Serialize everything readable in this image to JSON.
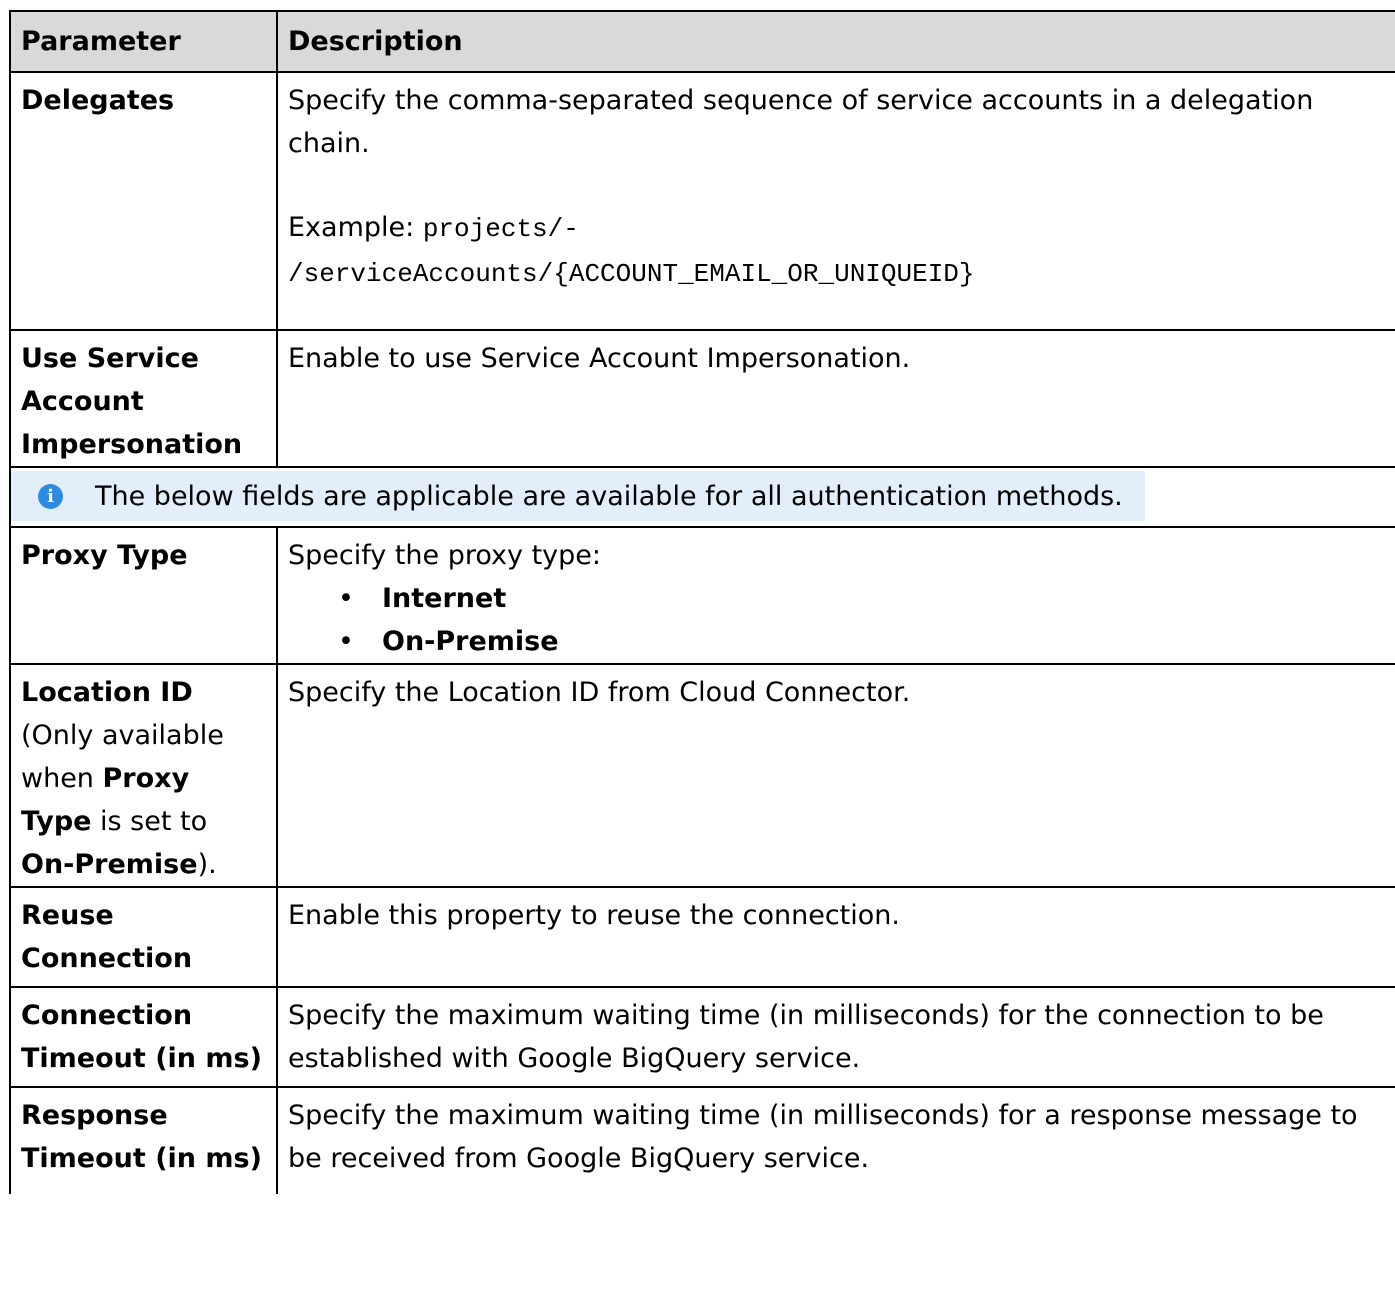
{
  "table": {
    "headers": {
      "parameter": "Parameter",
      "description": "Description"
    },
    "delegates": {
      "name": "Delegates",
      "desc": "Specify the comma-separated sequence of service accounts in a delegation chain.",
      "example_label": "Example:",
      "example_code_1": "projects/-",
      "example_code_2": "/serviceAccounts/{ACCOUNT_EMAIL_OR_UNIQUEID}"
    },
    "impersonation": {
      "name": "Use Service Account Impersonation",
      "desc": "Enable to use Service Account Impersonation."
    },
    "note": {
      "text": "The below fields are applicable are available for all authentication methods.",
      "icon": "info-icon"
    },
    "proxy_type": {
      "name": "Proxy Type",
      "desc": "Specify the proxy type:",
      "options": [
        "Internet",
        "On-Premise"
      ]
    },
    "location_id": {
      "name": "Location ID",
      "note_1": "(Only available when ",
      "note_bold_1": "Proxy Type",
      "note_2": " is set to ",
      "note_bold_2": "On-Premise",
      "note_3": ").",
      "desc": "Specify the Location ID from Cloud Connector."
    },
    "reuse": {
      "name": "Reuse Connection",
      "desc": "Enable this property to reuse the connection."
    },
    "conn_timeout": {
      "name": "Connection Timeout (in ms)",
      "desc": "Specify the maximum waiting time (in milliseconds) for the connection to be established with Google BigQuery service."
    },
    "resp_timeout": {
      "name": "Response Timeout (in ms)",
      "desc": "Specify the maximum waiting time (in milliseconds) for a response message to be received from Google BigQuery service."
    }
  }
}
